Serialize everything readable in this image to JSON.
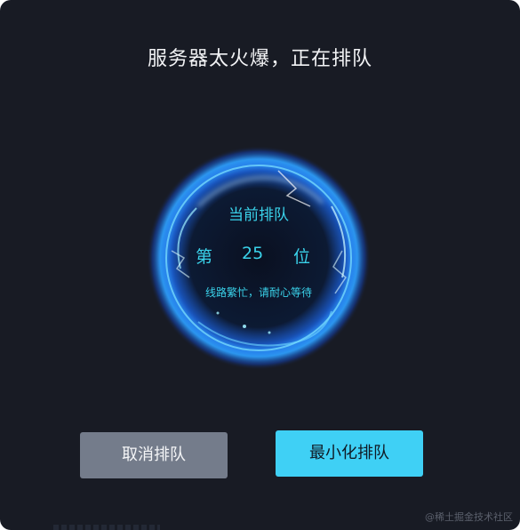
{
  "dialog": {
    "title": "服务器太火爆，正在排队"
  },
  "queue": {
    "label": "当前排队",
    "position_prefix": "第",
    "position": "25",
    "position_suffix": "位",
    "hint": "线路繁忙，请耐心等待"
  },
  "buttons": {
    "cancel_label": "取消排队",
    "minimize_label": "最小化排队"
  },
  "watermark": "@稀土掘金技术社区",
  "colors": {
    "background": "#181b24",
    "accent": "#3fd0f5",
    "cancel": "#747c8b",
    "orb_text": "#3ad2ea"
  }
}
